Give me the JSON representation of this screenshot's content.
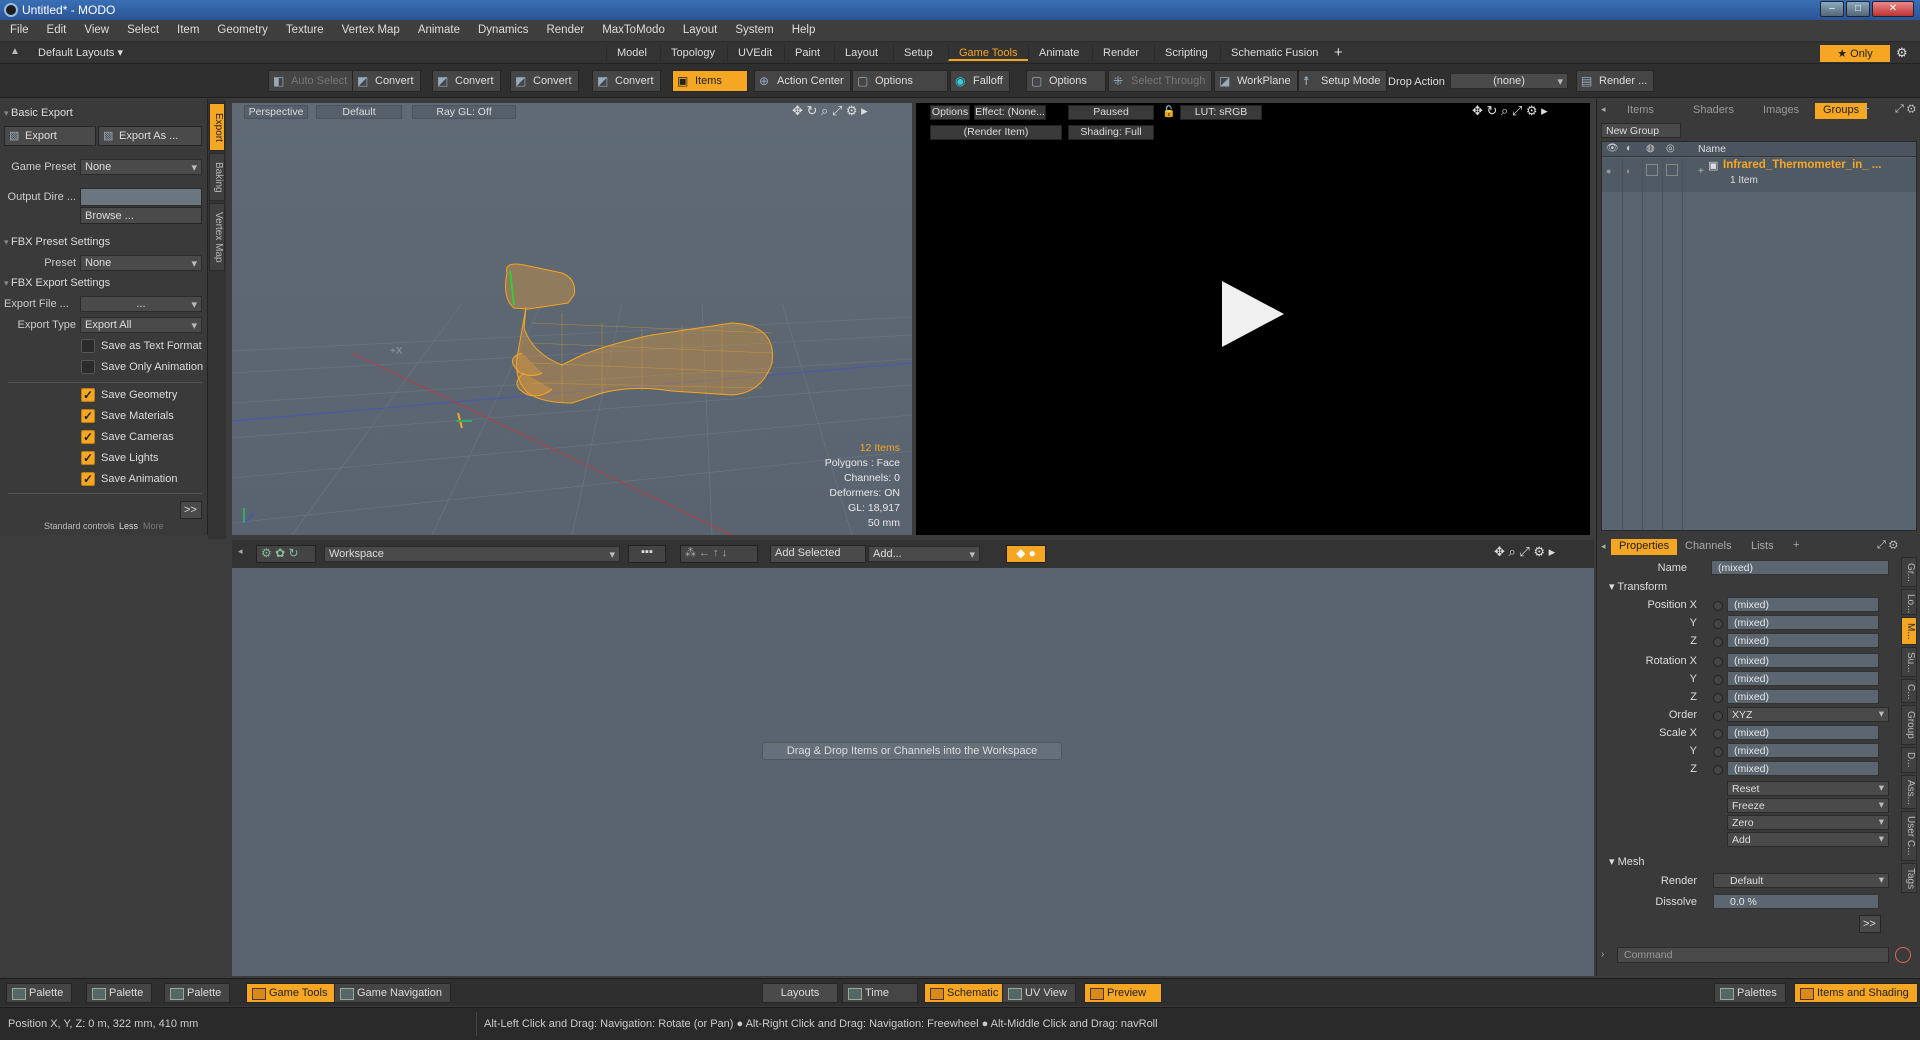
{
  "window": {
    "title": "Untitled* - MODO",
    "min": "–",
    "max": "□",
    "close": "✕"
  },
  "menu": [
    "File",
    "Edit",
    "View",
    "Select",
    "Item",
    "Geometry",
    "Texture",
    "Vertex Map",
    "Animate",
    "Dynamics",
    "Render",
    "MaxToModo",
    "Layout",
    "System",
    "Help"
  ],
  "layouts": {
    "default": "Default Layouts ▾",
    "tabs": [
      "Model",
      "Topology",
      "UVEdit",
      "Paint",
      "Layout",
      "Setup",
      "Game Tools",
      "Animate",
      "Render",
      "Scripting",
      "Schematic Fusion"
    ],
    "active": "Game Tools",
    "add": "+",
    "only": "★ Only"
  },
  "toolbar": {
    "auto_select": "Auto Select",
    "convert": "Convert",
    "items": "Items",
    "action_center": "Action Center",
    "options": "Options",
    "falloff": "Falloff",
    "select_through": "Select Through",
    "workplane": "WorkPlane",
    "setup_mode": "Setup Mode",
    "drop_action": "Drop Action",
    "drop_value": "(none)",
    "render": "Render ..."
  },
  "left": {
    "basic_export": "Basic Export",
    "export": "Export",
    "export_as": "Export As ...",
    "game_preset_label": "Game Preset",
    "game_preset": "None",
    "output_dir_label": "Output Dire ...",
    "browse": "Browse ...",
    "fbx_preset_settings": "FBX Preset Settings",
    "preset_label": "Preset",
    "preset": "None",
    "fbx_export_settings": "FBX Export Settings",
    "export_file_label": "Export File  ...",
    "export_file": "...",
    "export_type_label": "Export Type",
    "export_type": "Export All",
    "options": [
      {
        "label": "Save as Text Format",
        "on": false
      },
      {
        "label": "Save Only Animation",
        "on": false
      },
      {
        "label": "Save Geometry",
        "on": true
      },
      {
        "label": "Save Materials",
        "on": true
      },
      {
        "label": "Save Cameras",
        "on": true
      },
      {
        "label": "Save Lights",
        "on": true
      },
      {
        "label": "Save Animation",
        "on": true
      }
    ],
    "more_btn": ">>",
    "standard_controls": "Standard controls",
    "less": "Less",
    "more": "More",
    "vtabs": [
      "Export",
      "Baking",
      "Vertex Map"
    ]
  },
  "viewport": {
    "view": "Perspective",
    "style": "Default",
    "raygl": "Ray GL: Off",
    "items_count": "12 Items",
    "info": [
      "Polygons : Face",
      "Channels: 0",
      "Deformers: ON",
      "GL: 18,917",
      "50 mm"
    ]
  },
  "render": {
    "options": "Options",
    "effect": "Effect: (None...",
    "paused": "Paused",
    "lut": "LUT: sRGB",
    "render_item": "(Render Item)",
    "shading": "Shading: Full"
  },
  "itemlist": {
    "tabs": [
      "Items",
      "Shaders",
      "Images",
      "Groups"
    ],
    "active": "Groups",
    "new_group": "New Group",
    "name_col": "Name",
    "group_name": "Infrared_Thermometer_in_ ...",
    "group_count": "1 Item"
  },
  "workspace": {
    "name": "Workspace",
    "add_selected": "Add Selected",
    "add": "Add...",
    "drop_hint": "Drag & Drop Items or Channels into the Workspace"
  },
  "props": {
    "tabs": [
      "Properties",
      "Channels",
      "Lists"
    ],
    "active": "Properties",
    "name_label": "Name",
    "name": "(mixed)",
    "transform": "Transform",
    "rows": [
      {
        "label": "Position X",
        "value": "(mixed)"
      },
      {
        "label": "Y",
        "value": "(mixed)"
      },
      {
        "label": "Z",
        "value": "(mixed)"
      },
      {
        "label": "Rotation X",
        "value": "(mixed)"
      },
      {
        "label": "Y",
        "value": "(mixed)"
      },
      {
        "label": "Z",
        "value": "(mixed)"
      }
    ],
    "order_label": "Order",
    "order": "XYZ",
    "scale_rows": [
      {
        "label": "Scale X",
        "value": "(mixed)"
      },
      {
        "label": "Y",
        "value": "(mixed)"
      },
      {
        "label": "Z",
        "value": "(mixed)"
      }
    ],
    "actions": [
      "Reset",
      "Freeze",
      "Zero",
      "Add"
    ],
    "mesh": "Mesh",
    "render_label": "Render",
    "render_value": "Default",
    "dissolve_label": "Dissolve",
    "dissolve_value": "0.0 %",
    "vtabs": [
      "Gr...",
      "Lo...",
      "M...",
      "Su...",
      "C...",
      "Group",
      "D...",
      "Ass...",
      "User C...",
      "Tags"
    ],
    "more": ">>",
    "command": "Command"
  },
  "bottom": {
    "left": [
      "Palette",
      "Palette",
      "Palette",
      "Game Tools",
      "Game Navigation"
    ],
    "mid": [
      "Layouts",
      "Time",
      "Schematic",
      "UV View",
      "Preview"
    ],
    "right": [
      "Palettes",
      "Items and Shading"
    ]
  },
  "status": {
    "position": "Position X, Y, Z:   0 m, 322 mm, 410 mm",
    "hint": "Alt-Left Click and Drag: Navigation: Rotate (or Pan) ● Alt-Right Click and Drag: Navigation: Freewheel ● Alt-Middle Click and Drag: navRoll"
  }
}
